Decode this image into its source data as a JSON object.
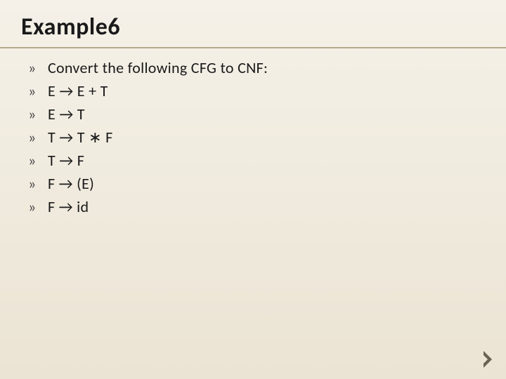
{
  "title": "Example6",
  "bullets": [
    "Convert the following CFG to CNF:",
    "E → E + T",
    "E → T",
    "T → T ∗ F",
    "T → F",
    "F → (E)",
    "F → id"
  ],
  "bullet_marker": "»"
}
